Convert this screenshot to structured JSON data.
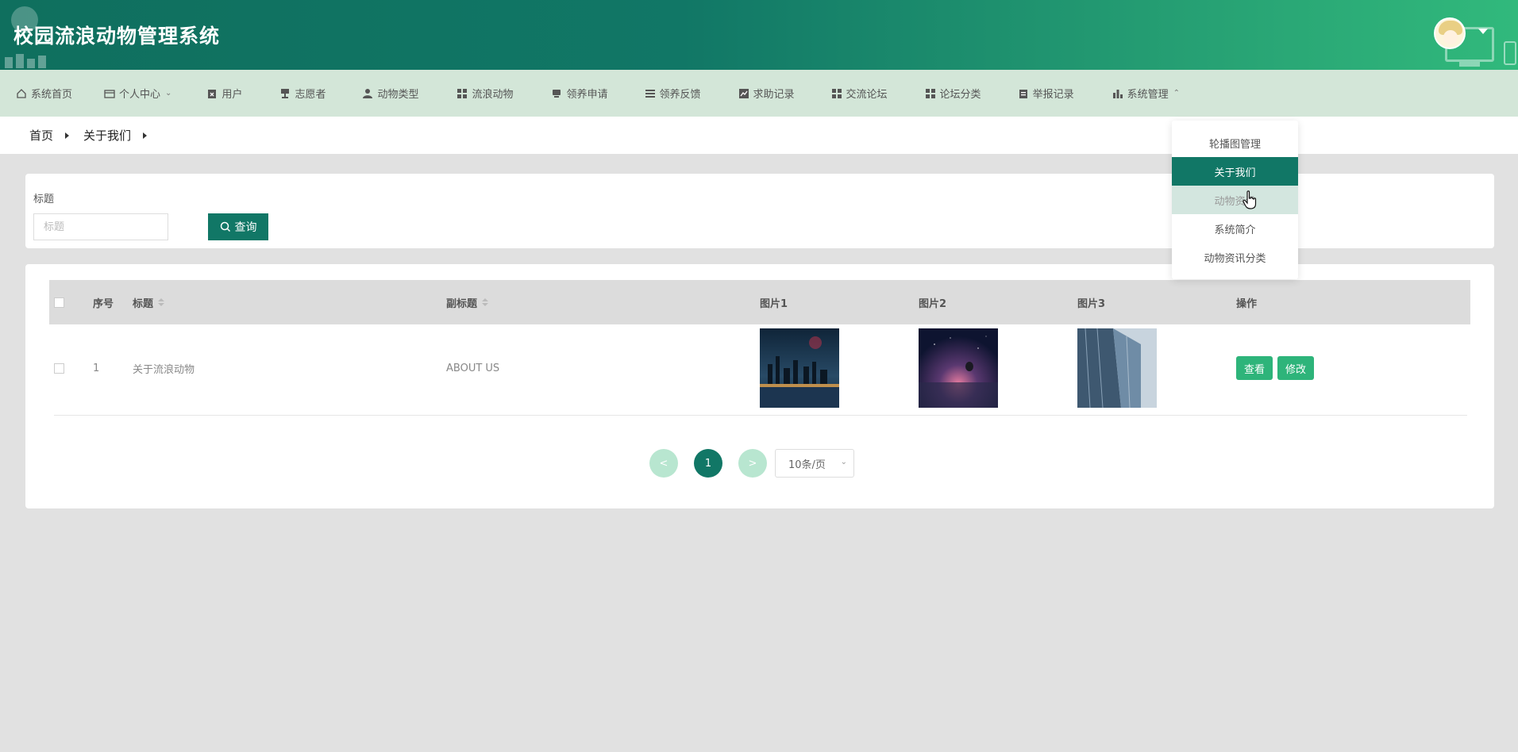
{
  "header": {
    "title": "校园流浪动物管理系统"
  },
  "nav": {
    "items": [
      {
        "label": "系统首页",
        "icon": "home-icon"
      },
      {
        "label": "个人中心",
        "icon": "wallet-icon",
        "chevron": "down"
      },
      {
        "label": "用户",
        "icon": "clipboard-x-icon"
      },
      {
        "label": "志愿者",
        "icon": "stamp-icon"
      },
      {
        "label": "动物类型",
        "icon": "user-icon"
      },
      {
        "label": "流浪动物",
        "icon": "grid-icon"
      },
      {
        "label": "领养申请",
        "icon": "monitor-icon"
      },
      {
        "label": "领养反馈",
        "icon": "list-icon"
      },
      {
        "label": "求助记录",
        "icon": "chart-line-icon"
      },
      {
        "label": "交流论坛",
        "icon": "grid-icon"
      },
      {
        "label": "论坛分类",
        "icon": "grid-icon"
      },
      {
        "label": "举报记录",
        "icon": "clipboard-icon"
      },
      {
        "label": "系统管理",
        "icon": "bar-chart-icon",
        "chevron": "up"
      }
    ]
  },
  "breadcrumb": {
    "home": "首页",
    "current": "关于我们"
  },
  "search": {
    "label": "标题",
    "placeholder": "标题",
    "button": "查询"
  },
  "table": {
    "headers": {
      "index": "序号",
      "title": "标题",
      "subtitle": "副标题",
      "image1": "图片1",
      "image2": "图片2",
      "image3": "图片3",
      "actions": "操作"
    },
    "rows": [
      {
        "index": "1",
        "title": "关于流浪动物",
        "subtitle": "ABOUT US",
        "view": "查看",
        "edit": "修改"
      }
    ]
  },
  "pagination": {
    "prev": "<",
    "current": "1",
    "next": ">",
    "page_size": "10条/页"
  },
  "dropdown": {
    "items": [
      {
        "label": "轮播图管理",
        "state": "normal"
      },
      {
        "label": "关于我们",
        "state": "active"
      },
      {
        "label": "动物资讯",
        "state": "hover"
      },
      {
        "label": "系统简介",
        "state": "normal"
      },
      {
        "label": "动物资讯分类",
        "state": "normal"
      }
    ]
  },
  "colors": {
    "primary": "#117766",
    "accent": "#2eb47a",
    "nav_bg": "#d3e6d8",
    "page_bg": "#e1e1e1"
  }
}
